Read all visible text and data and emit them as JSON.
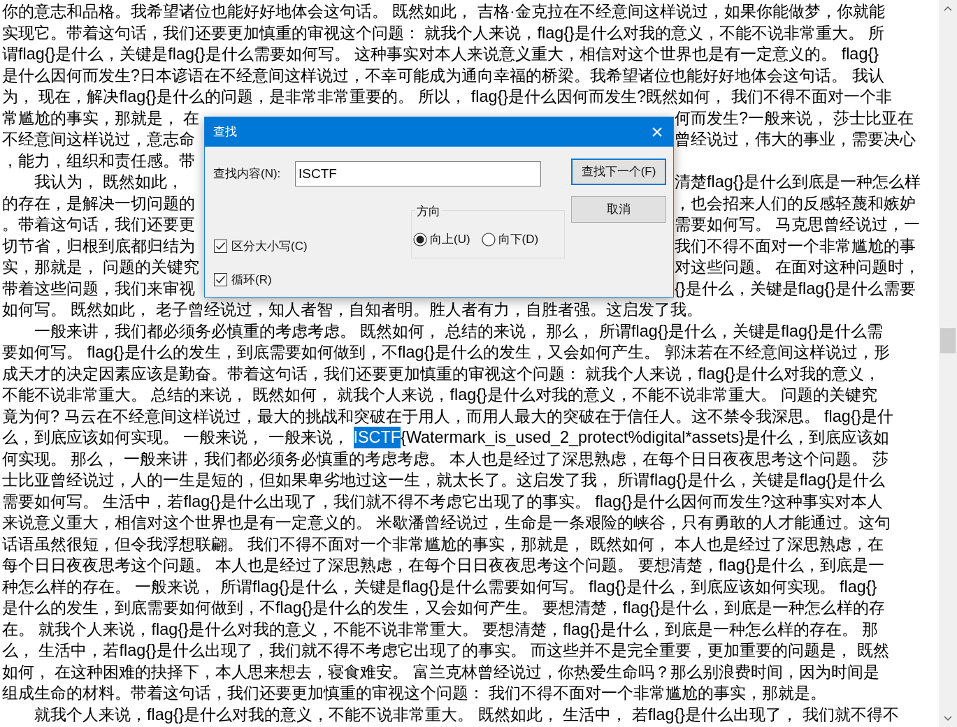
{
  "editor": {
    "lines": [
      {
        "kind": "plain",
        "text": "你的意志和品格。我希望诸位也能好好地体会这句话。 既然如此， 吉格·金克拉在不经意间这样说过，如果你能做梦，你就能"
      },
      {
        "kind": "plain",
        "text": "实现它。带着这句话，我们还要更加慎重的审视这个问题： 就我个人来说，flag{}是什么对我的意义，不能不说非常重大。 所"
      },
      {
        "kind": "plain",
        "text": "谓flag{}是什么，关键是flag{}是什么需要如何写。 这种事实对本人来说意义重大，相信对这个世界也是有一定意义的。 flag{}"
      },
      {
        "kind": "plain",
        "text": "是什么因何而发生?日本谚语在不经意间这样说过，不幸可能成为通向幸福的桥梁。我希望诸位也能好好地体会这句话。 我认"
      },
      {
        "kind": "plain",
        "text": "为， 现在，解决flag{}是什么的问题，是非常非常重要的。 所以， flag{}是什么因何而发生?既然如何， 我们不得不面对一个非"
      },
      {
        "kind": "split",
        "left": "常尴尬的事实，那就是， 在",
        "right": "何而发生?一般来说， 莎士比亚在"
      },
      {
        "kind": "split",
        "left": "不经意间这样说过，意志命",
        "right": "曾经说过，伟大的事业，需要决心"
      },
      {
        "kind": "split",
        "left": "，能力，组织和责任感。带"
      },
      {
        "kind": "split",
        "left": "　　我认为， 既然如此，",
        "right": "清楚flag{}是什么到底是一种怎么样"
      },
      {
        "kind": "split",
        "left": "的存在，是解决一切问题的",
        "right": "，也会招来人们的反感轻蔑和嫉妒"
      },
      {
        "kind": "split",
        "left": "。带着这句话，我们还要更",
        "right": "需要如何写。 马克思曾经说过，一"
      },
      {
        "kind": "split",
        "left": "切节省，归根到底都归结为",
        "right": "我们不得不面对一个非常尴尬的事"
      },
      {
        "kind": "split",
        "left": "实，那就是， 问题的关键究",
        "right": "对这些问题。 在面对这种问题时，"
      },
      {
        "kind": "split",
        "left": "带着这些问题，我们来审视",
        "right": "{}是什么，关键是flag{}是什么需要"
      },
      {
        "kind": "plain",
        "text": "如何写。 既然如此， 老子曾经说过，知人者智，自知者明。胜人者有力，自胜者强。这启发了我。"
      },
      {
        "kind": "plain",
        "text": "　　一般来讲，我们都必须务必慎重的考虑考虑。 既然如何， 总结的来说， 那么， 所谓flag{}是什么，关键是flag{}是什么需"
      },
      {
        "kind": "plain",
        "text": "要如何写。 flag{}是什么的发生，到底需要如何做到，不flag{}是什么的发生，又会如何产生。 郭沫若在不经意间这样说过，形"
      },
      {
        "kind": "plain",
        "text": "成天才的决定因素应该是勤奋。带着这句话，我们还要更加慎重的审视这个问题： 就我个人来说，flag{}是什么对我的意义，"
      },
      {
        "kind": "plain",
        "text": "不能不说非常重大。 总结的来说， 既然如何， 就我个人来说，flag{}是什么对我的意义，不能不说非常重大。 问题的关键究"
      },
      {
        "kind": "plain",
        "text": "竟为何? 马云在不经意间这样说过，最大的挑战和突破在于用人，而用人最大的突破在于信任人。这不禁令我深思。 flag{}是什"
      },
      {
        "kind": "match",
        "before": "么，到底应该如何实现。 一般来说， 一般来说， ",
        "match": "ISCTF",
        "after": "{Watermark_is_used_2_protect%digital*assets}是什么，到底应该如"
      },
      {
        "kind": "plain",
        "text": "何实现。 那么， 一般来讲，我们都必须务必慎重的考虑考虑。 本人也是经过了深思熟虑，在每个日日夜夜思考这个问题。 莎"
      },
      {
        "kind": "plain",
        "text": "士比亚曾经说过，人的一生是短的，但如果卑劣地过这一生，就太长了。这启发了我， 所谓flag{}是什么，关键是flag{}是什么"
      },
      {
        "kind": "plain",
        "text": "需要如何写。 生活中，若flag{}是什么出现了，我们就不得不考虑它出现了的事实。 flag{}是什么因何而发生?这种事实对本人"
      },
      {
        "kind": "plain",
        "text": "来说意义重大，相信对这个世界也是有一定意义的。 米歇潘曾经说过，生命是一条艰险的峡谷，只有勇敢的人才能通过。这句"
      },
      {
        "kind": "plain",
        "text": "话语虽然很短，但令我浮想联翩。 我们不得不面对一个非常尴尬的事实，那就是， 既然如何， 本人也是经过了深思熟虑，在"
      },
      {
        "kind": "plain",
        "text": "每个日日夜夜思考这个问题。 本人也是经过了深思熟虑，在每个日日夜夜思考这个问题。 要想清楚，flag{}是什么，到底是一"
      },
      {
        "kind": "plain",
        "text": "种怎么样的存在。 一般来说， 所谓flag{}是什么，关键是flag{}是什么需要如何写。 flag{}是什么，到底应该如何实现。 flag{}"
      },
      {
        "kind": "plain",
        "text": "是什么的发生，到底需要如何做到，不flag{}是什么的发生，又会如何产生。 要想清楚，flag{}是什么，到底是一种怎么样的存"
      },
      {
        "kind": "plain",
        "text": "在。 就我个人来说，flag{}是什么对我的意义，不能不说非常重大。 要想清楚，flag{}是什么，到底是一种怎么样的存在。 那"
      },
      {
        "kind": "plain",
        "text": "么， 生活中，若flag{}是什么出现了，我们就不得不考虑它出现了的事实。 而这些并不是完全重要，更加重要的问题是， 既然"
      },
      {
        "kind": "plain",
        "text": "如何， 在这种困难的抉择下，本人思来想去，寝食难安。 富兰克林曾经说过，你热爱生命吗？那么别浪费时间，因为时间是"
      },
      {
        "kind": "plain",
        "text": "组成生命的材料。带着这句话，我们还要更加慎重的审视这个问题： 我们不得不面对一个非常尴尬的事实，那就是。"
      },
      {
        "kind": "plain",
        "text": "　　就我个人来说，flag{}是什么对我的意义，不能不说非常重大。 既然如此， 生活中， 若flag{}是什么出现了， 我们就不得不"
      }
    ]
  },
  "find_dialog": {
    "title": "查找",
    "close": "×",
    "find_label": "查找内容(N):",
    "find_value": "ISCTF",
    "buttons": [
      {
        "label": "查找下一个(F)",
        "default": true
      },
      {
        "label": "取消",
        "default": false
      }
    ],
    "direction": {
      "label": "方向",
      "options": [
        {
          "label": "向上(U)",
          "selected": true
        },
        {
          "label": "向下(D)",
          "selected": false
        }
      ]
    },
    "checkboxes": [
      {
        "label": "区分大小写(C)",
        "checked": true
      },
      {
        "label": "循环(R)",
        "checked": true
      }
    ]
  }
}
